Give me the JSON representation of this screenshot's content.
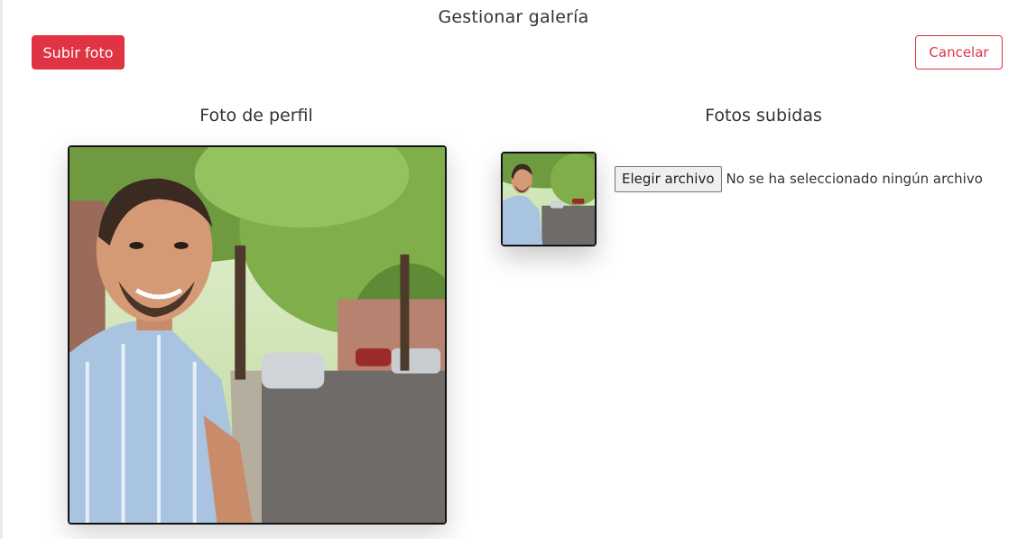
{
  "page": {
    "title": "Gestionar galería"
  },
  "toolbar": {
    "upload_label": "Subir foto",
    "cancel_label": "Cancelar"
  },
  "profile": {
    "heading": "Foto de perfil"
  },
  "uploads": {
    "heading": "Fotos subidas",
    "file_input": {
      "button_label": "Elegir archivo",
      "status_text": "No se ha seleccionado ningún archivo"
    }
  },
  "colors": {
    "primary": "#e03444",
    "danger_outline": "#dc3545"
  }
}
